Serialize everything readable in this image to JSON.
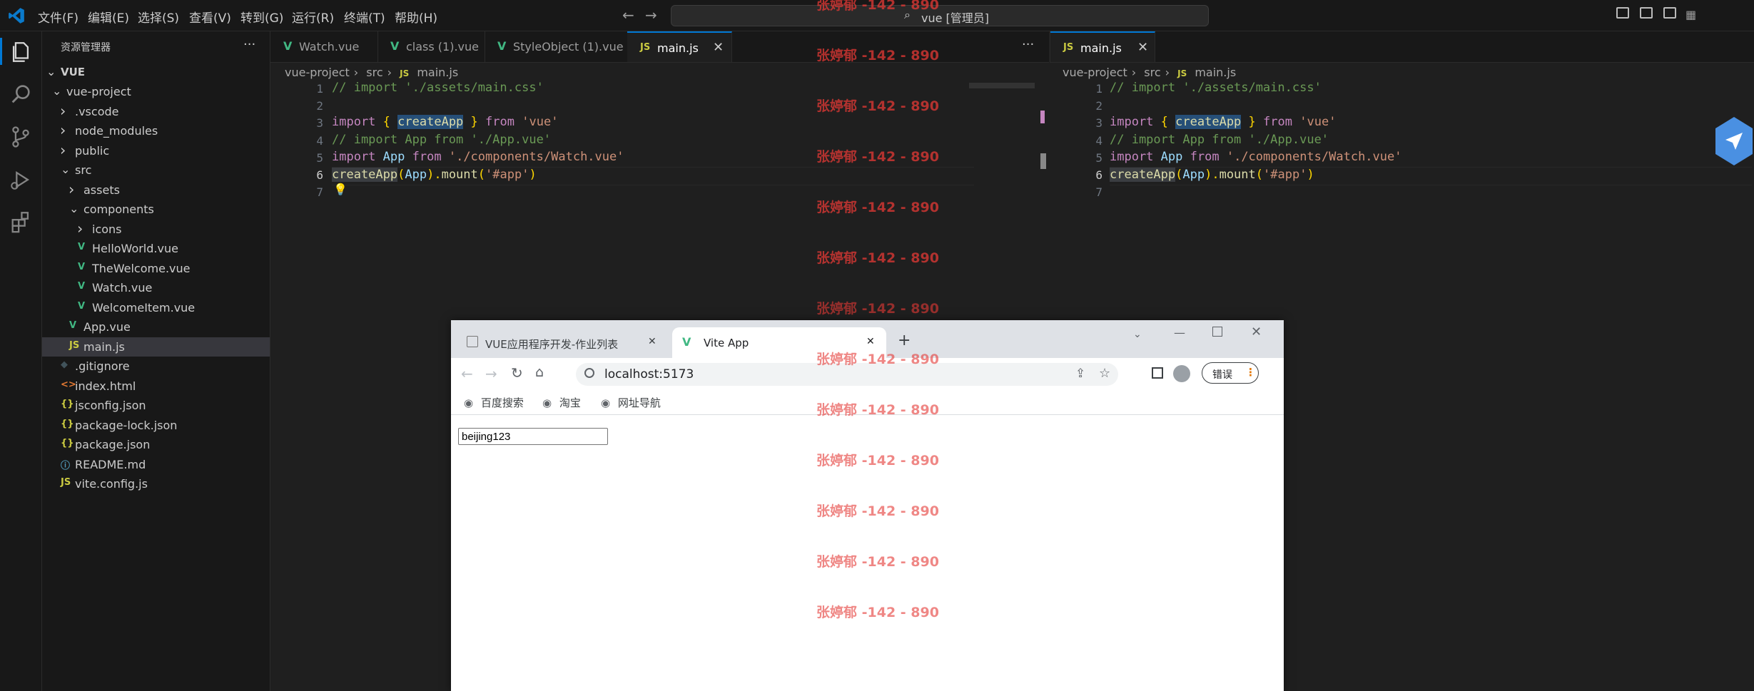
{
  "window": {
    "search_text": "vue [管理员]",
    "menu": [
      "文件(F)",
      "编辑(E)",
      "选择(S)",
      "查看(V)",
      "转到(G)",
      "运行(R)",
      "终端(T)",
      "帮助(H)"
    ]
  },
  "sidebar": {
    "title": "资源管理器",
    "more": "···",
    "root": "VUE",
    "items": [
      {
        "label": "vue-project",
        "icon": "chevron-down",
        "depth": 1
      },
      {
        "label": ".vscode",
        "icon": "chevron-right",
        "depth": 2
      },
      {
        "label": "node_modules",
        "icon": "chevron-right",
        "depth": 2
      },
      {
        "label": "public",
        "icon": "chevron-right",
        "depth": 2
      },
      {
        "label": "src",
        "icon": "chevron-down",
        "depth": 2
      },
      {
        "label": "assets",
        "icon": "chevron-right",
        "depth": 3
      },
      {
        "label": "components",
        "icon": "chevron-down",
        "depth": 3
      },
      {
        "label": "icons",
        "icon": "chevron-right",
        "depth": 4
      },
      {
        "label": "HelloWorld.vue",
        "icon": "vue",
        "depth": 4
      },
      {
        "label": "TheWelcome.vue",
        "icon": "vue",
        "depth": 4
      },
      {
        "label": "Watch.vue",
        "icon": "vue",
        "depth": 4
      },
      {
        "label": "WelcomeItem.vue",
        "icon": "vue",
        "depth": 4
      },
      {
        "label": "App.vue",
        "icon": "vue",
        "depth": 3
      },
      {
        "label": "main.js",
        "icon": "js",
        "depth": 3,
        "selected": true
      },
      {
        "label": ".gitignore",
        "icon": "git",
        "depth": 2
      },
      {
        "label": "index.html",
        "icon": "html",
        "depth": 2
      },
      {
        "label": "jsconfig.json",
        "icon": "json",
        "depth": 2
      },
      {
        "label": "package-lock.json",
        "icon": "json",
        "depth": 2
      },
      {
        "label": "package.json",
        "icon": "json",
        "depth": 2
      },
      {
        "label": "README.md",
        "icon": "info",
        "depth": 2
      },
      {
        "label": "vite.config.js",
        "icon": "js",
        "depth": 2
      }
    ]
  },
  "editor_left": {
    "tabs": [
      "Watch.vue",
      "class (1).vue",
      "StyleObject (1).vue",
      "main.js"
    ],
    "tab_close": "✕",
    "more": "···",
    "breadcrumb": [
      "vue-project",
      "src",
      "main.js"
    ]
  },
  "editor_right": {
    "tab": "main.js",
    "tab_close": "✕",
    "breadcrumb": [
      "vue-project",
      "src",
      "main.js"
    ]
  },
  "code": {
    "line_numbers": [
      "1",
      "2",
      "3",
      "4",
      "5",
      "6",
      "7"
    ],
    "l1": "// import './assets/main.css'",
    "l3_kw": "import",
    "l3_b1": "{",
    "l3_fn": "createApp",
    "l3_b2": "}",
    "l3_from": "from",
    "l3_str": "'vue'",
    "l4": "// import App from './App.vue'",
    "l5_kw": "import",
    "l5_var": "App",
    "l5_from": "from",
    "l5_str": "'./components/Watch.vue'",
    "l6_fn": "createApp",
    "l6_p1": "(",
    "l6_var": "App",
    "l6_p2": ").",
    "l6_fn2": "mount",
    "l6_p3": "(",
    "l6_str": "'#app'",
    "l6_p4": ")"
  },
  "browser": {
    "tabs": [
      "VUE应用程序开发-作业列表",
      "Vite App"
    ],
    "close": "✕",
    "new_tab": "+",
    "url": "localhost:5173",
    "profile_button": "错误",
    "bookmarks": [
      "百度搜索",
      "淘宝",
      "网址导航"
    ],
    "input_value": "beijing123"
  },
  "watermark": {
    "text": "张婷郁 -142 - 890"
  }
}
